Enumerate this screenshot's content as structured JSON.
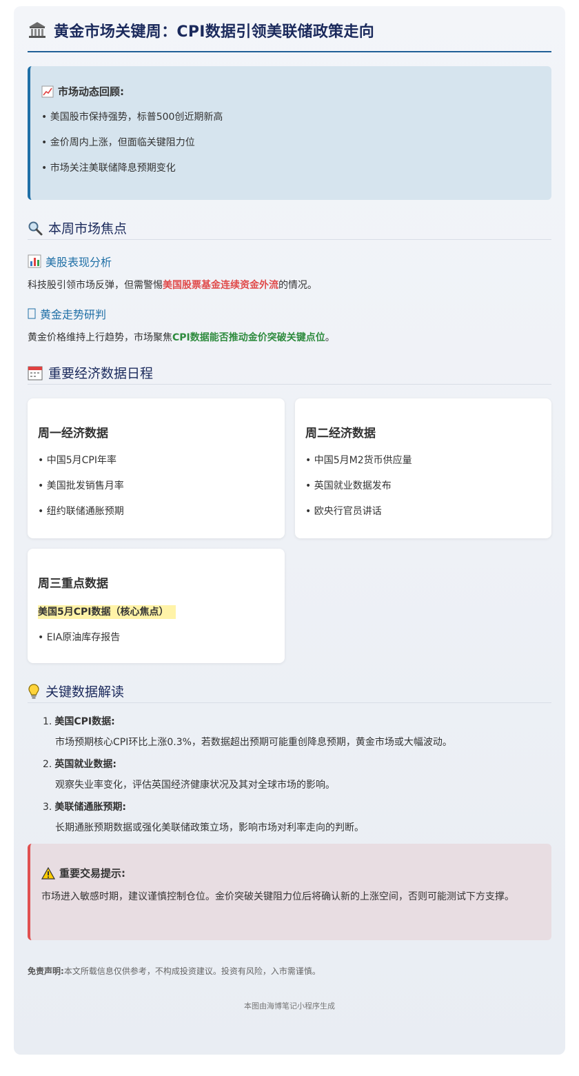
{
  "header": {
    "title": "黄金市场关键周：CPI数据引领美联储政策走向",
    "icon": "bank-icon"
  },
  "review": {
    "heading": "市场动态回顾:",
    "icon": "chart-up-icon",
    "bullets": [
      "• 美国股市保持强势，标普500创近期新高",
      "• 金价周内上涨，但面临关键阻力位",
      "• 市场关注美联储降息预期变化"
    ]
  },
  "focus": {
    "title": "本周市场焦点",
    "icon": "magnifier-icon",
    "stocks": {
      "title": "美股表现分析",
      "icon": "bar-chart-icon",
      "text_before": "科技股引领市场反弹，但需警惕",
      "highlight": "美国股票基金连续资金外流",
      "text_after": "的情况。"
    },
    "gold": {
      "title": "黄金走势研判",
      "icon": "missing-glyph-icon",
      "text_before": "黄金价格维持上行趋势，市场聚焦",
      "highlight": "CPI数据能否推动金价突破关键点位",
      "text_after": "。"
    }
  },
  "calendar": {
    "title": "重要经济数据日程",
    "icon": "calendar-icon",
    "cards": [
      {
        "title": "周一经济数据",
        "items": [
          "• 中国5月CPI年率",
          "• 美国批发销售月率",
          "• 纽约联储通胀预期"
        ]
      },
      {
        "title": "周二经济数据",
        "items": [
          "• 中国5月M2货币供应量",
          "• 英国就业数据发布",
          "• 欧央行官员讲话"
        ]
      },
      {
        "title": "周三重点数据",
        "focus": "美国5月CPI数据（核心焦点）",
        "items": [
          "• EIA原油库存报告"
        ]
      }
    ]
  },
  "interpretation": {
    "title": "关键数据解读",
    "icon": "lightbulb-icon",
    "items": [
      {
        "num": "1.",
        "head": "美国CPI数据:",
        "body": "市场预期核心CPI环比上涨0.3%，若数据超出预期可能重创降息预期，黄金市场或大幅波动。"
      },
      {
        "num": "2.",
        "head": "英国就业数据:",
        "body": "观察失业率变化，评估英国经济健康状况及其对全球市场的影响。"
      },
      {
        "num": "3.",
        "head": "美联储通胀预期:",
        "body": "长期通胀预期数据或强化美联储政策立场，影响市场对利率走向的判断。"
      }
    ]
  },
  "warning": {
    "heading": "重要交易提示:",
    "icon": "warning-icon",
    "text": "市场进入敏感时期，建议谨慎控制仓位。金价突破关键阻力位后将确认新的上涨空间，否则可能测试下方支撑。"
  },
  "disclaimer": {
    "label": "免责声明:",
    "text": "本文所载信息仅供参考，不构成投资建议。投资有风险，入市需谨慎。"
  },
  "footer": "本图由海博笔记小程序生成"
}
